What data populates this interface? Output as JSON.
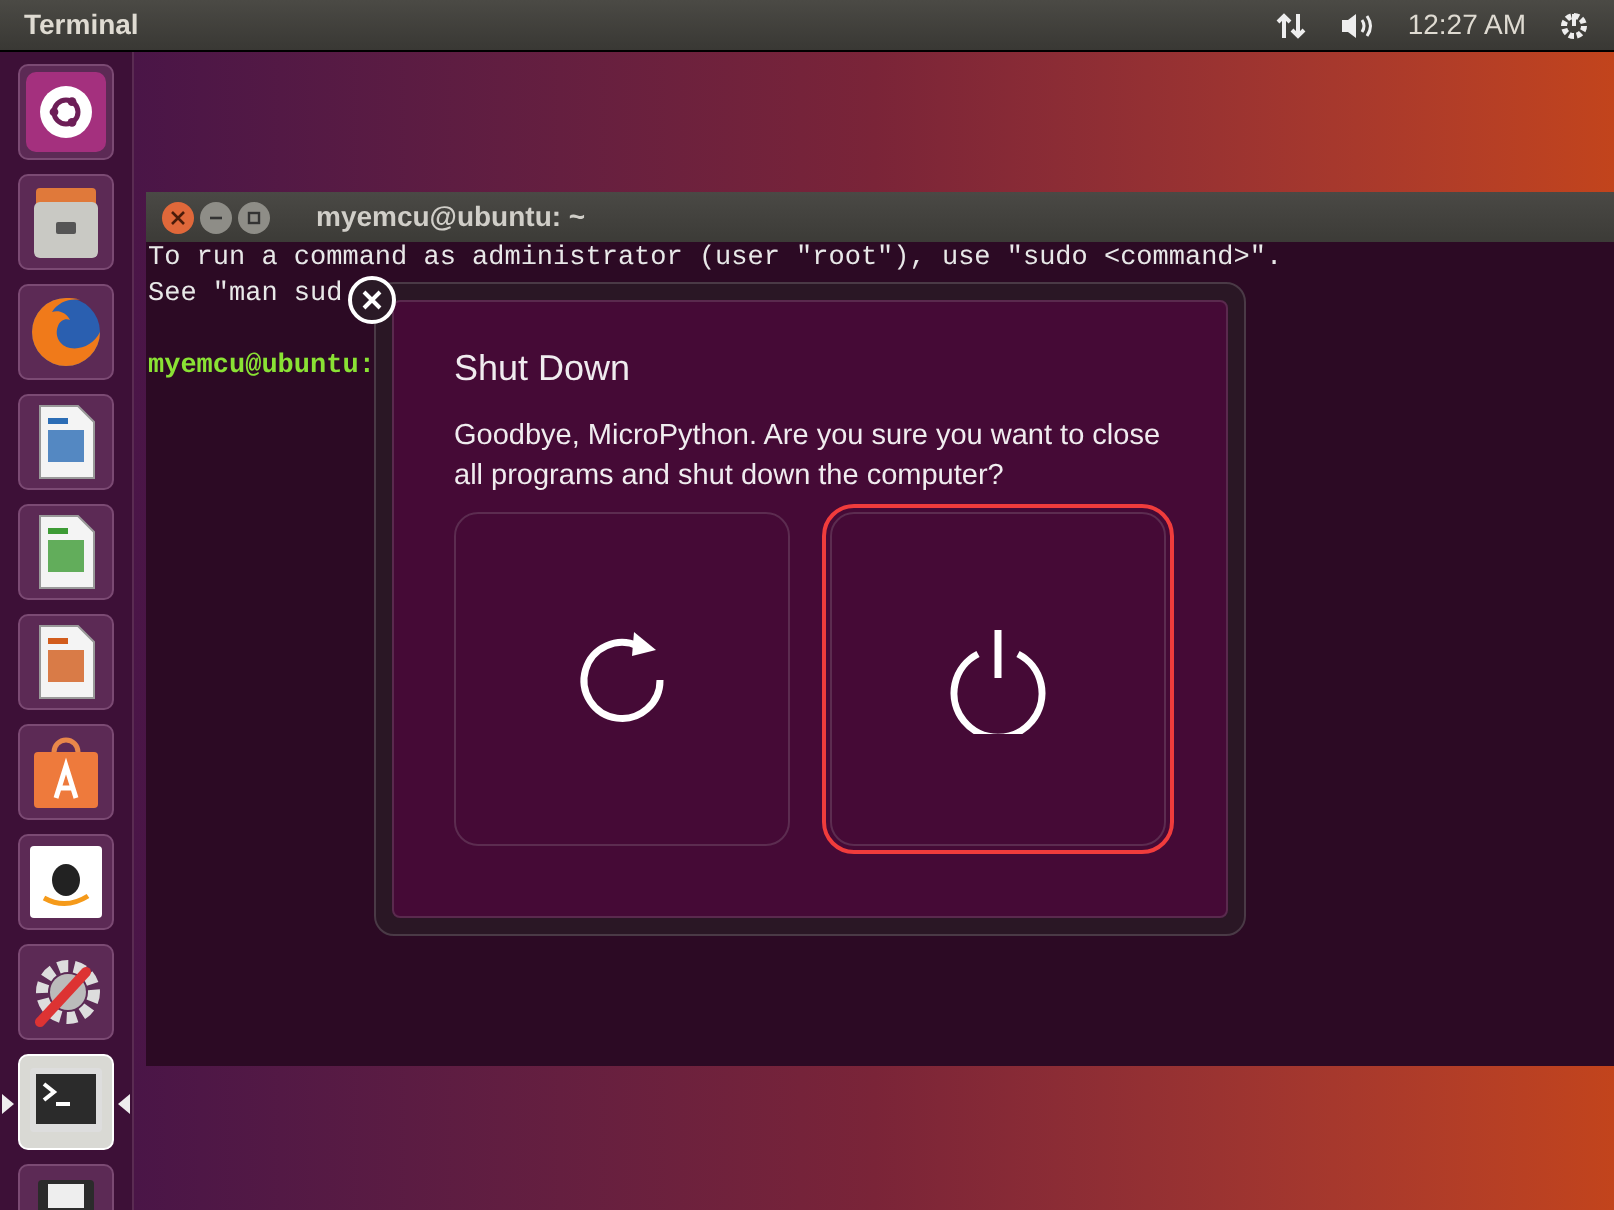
{
  "top_bar": {
    "title": "Terminal",
    "clock": "12:27 AM"
  },
  "launcher": [
    {
      "kind": "dash",
      "focused": false
    },
    {
      "kind": "files",
      "focused": false
    },
    {
      "kind": "browser",
      "focused": false
    },
    {
      "kind": "writer",
      "focused": false
    },
    {
      "kind": "calc",
      "focused": false
    },
    {
      "kind": "impress",
      "focused": false
    },
    {
      "kind": "store",
      "focused": false
    },
    {
      "kind": "shop",
      "focused": false
    },
    {
      "kind": "settings",
      "focused": false
    },
    {
      "kind": "terminal",
      "focused": true
    },
    {
      "kind": "drive",
      "focused": false
    }
  ],
  "terminal": {
    "title": "myemcu@ubuntu: ~",
    "lines": [
      "To run a command as administrator (user \"root\"), use \"sudo <command>\".",
      "See \"man sud"
    ],
    "prompt": "myemcu@ubuntu:"
  },
  "dialog": {
    "title": "Shut Down",
    "message": "Goodbye, MicroPython. Are you sure you want to close all programs and shut down the computer?",
    "options": [
      {
        "kind": "restart",
        "selected": false
      },
      {
        "kind": "power",
        "selected": true
      }
    ]
  }
}
